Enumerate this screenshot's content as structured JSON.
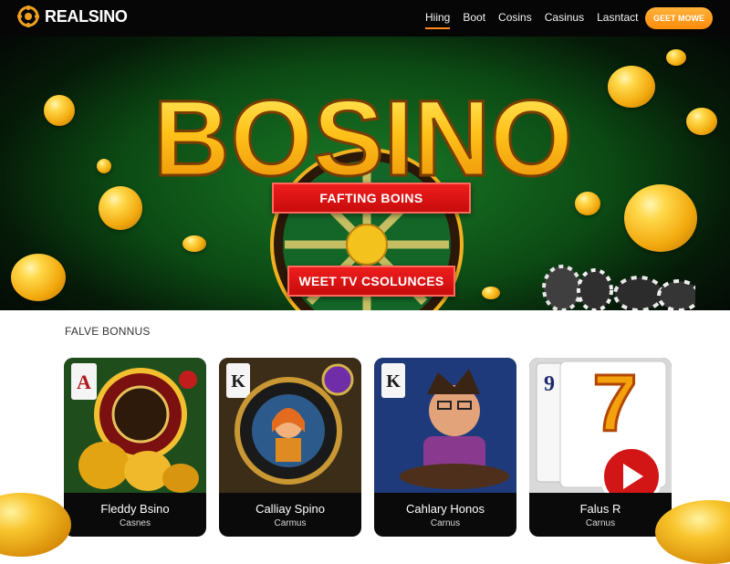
{
  "header": {
    "brand": "REALSINO",
    "nav": [
      "Hiing",
      "Boot",
      "Cosins",
      "Casinus",
      "Lasntact"
    ],
    "cta_label": "GEET MOWE"
  },
  "hero": {
    "title": "BOSINO",
    "promo_top": "FAFTING BOINS",
    "promo_bottom": "WEET TV CSOLUNCES"
  },
  "section": {
    "title": "FALVE BONNUS"
  },
  "cards": [
    {
      "corner": "A",
      "title": "Fleddy Bsino",
      "subtitle": "Casnes"
    },
    {
      "corner": "K",
      "title": "Calliay Spino",
      "subtitle": "Carmus"
    },
    {
      "corner": "K",
      "title": "Cahlary Honos",
      "subtitle": "Carnus"
    },
    {
      "corner": "9",
      "title": "Falus R",
      "subtitle": "Carnus"
    }
  ],
  "colors": {
    "accent": "#ff8a17",
    "promo_red": "#d91414",
    "hero_green": "#0c4a14",
    "coin_gold": "#f2a90e"
  }
}
